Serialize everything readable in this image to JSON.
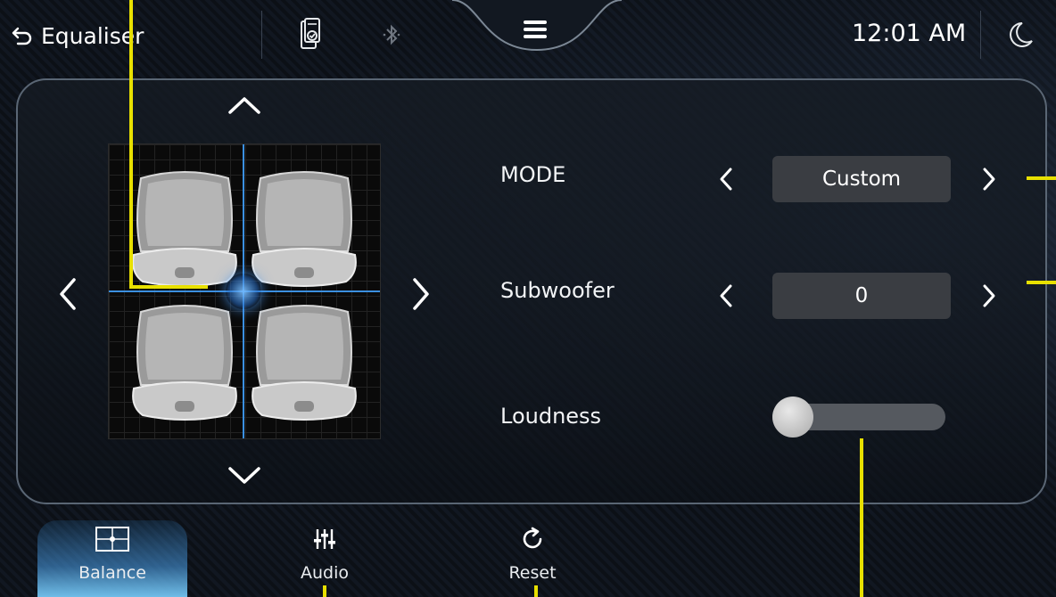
{
  "header": {
    "title": "Equaliser",
    "clock": "12:01 AM"
  },
  "settings": {
    "mode": {
      "label": "MODE",
      "value": "Custom"
    },
    "subwoofer": {
      "label": "Subwoofer",
      "value": "0"
    },
    "loudness": {
      "label": "Loudness",
      "level": 0
    }
  },
  "balance": {
    "fader": 0,
    "balance": 0,
    "seats": 4
  },
  "tabs": [
    {
      "label": "Balance",
      "icon": "balance-grid-icon",
      "active": true
    },
    {
      "label": "Audio",
      "icon": "sliders-icon",
      "active": false
    },
    {
      "label": "Reset",
      "icon": "reset-icon",
      "active": false
    }
  ],
  "colors": {
    "accent": "#3b8fe0",
    "active_tab": "#6fbde8",
    "annotation": "#e8e000",
    "value_box": "#3a3d42"
  }
}
